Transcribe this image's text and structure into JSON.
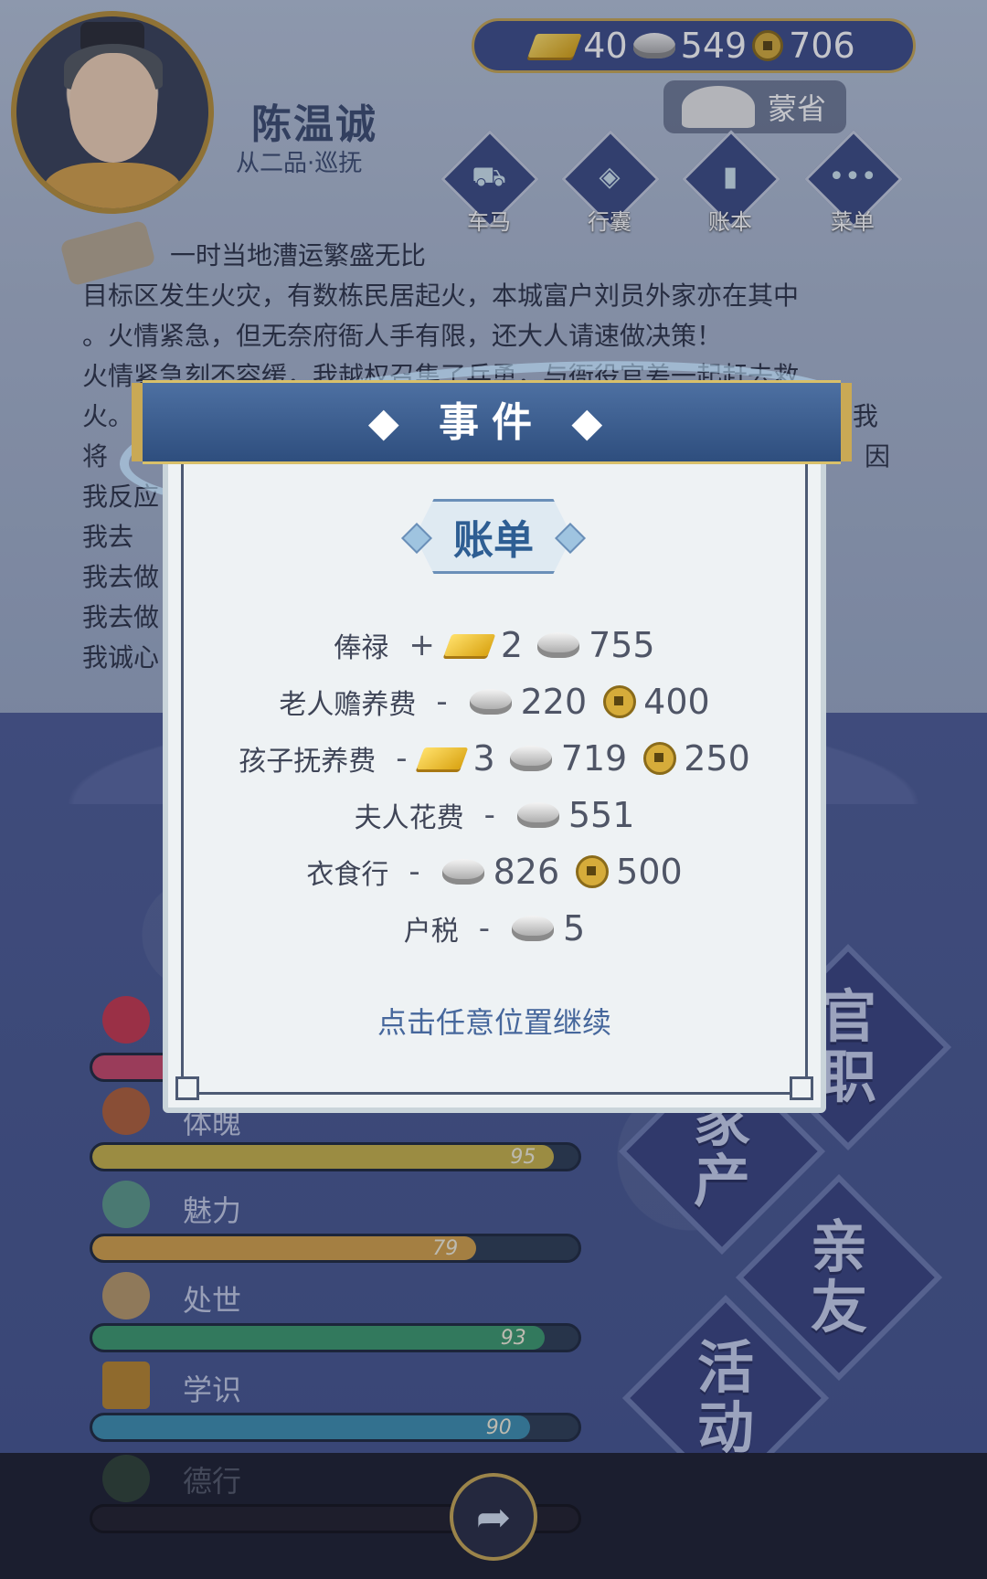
{
  "player": {
    "name": "陈温诚",
    "rank": "从二品·巡抚",
    "province": "蒙省"
  },
  "currency": {
    "gold": "40",
    "silver": "549",
    "coin": "706"
  },
  "nav": [
    {
      "label": "车马",
      "icon": "carriage-icon"
    },
    {
      "label": "行囊",
      "icon": "bag-icon"
    },
    {
      "label": "账本",
      "icon": "ledger-icon"
    },
    {
      "label": "菜单",
      "icon": "menu-dots-icon"
    }
  ],
  "story": {
    "lines": [
      "一时当地漕运繁盛无比",
      "目标区发生火灾，有数栋民居起火，本城富户刘员外家亦在其中",
      "。火情紧急，但无奈府衙人手有限，还大人请速做决策！",
      "火情紧急刻不容缓，我越权召集了兵勇，与衙役官差一起赶去救",
      "火。",
      "将",
      "我反应",
      "我去",
      "我去做",
      "我去做",
      "我诚心"
    ],
    "right_fragments": [
      "灭.我",
      "因"
    ]
  },
  "big_buttons": [
    {
      "label_1": "官",
      "label_2": "职"
    },
    {
      "label_1": "家",
      "label_2": "产"
    },
    {
      "label_1": "亲",
      "label_2": "友"
    },
    {
      "label_1": "活",
      "label_2": "动"
    }
  ],
  "stats": [
    {
      "label": "",
      "value": "",
      "fraction": 0.42,
      "color": "#c7486a"
    },
    {
      "label": "体魄",
      "value": "95",
      "fraction": 0.95,
      "color": "#c9b34a"
    },
    {
      "label": "魅力",
      "value": "79",
      "fraction": 0.79,
      "color": "#d5a24a"
    },
    {
      "label": "处世",
      "value": "93",
      "fraction": 0.93,
      "color": "#3c9a6e"
    },
    {
      "label": "学识",
      "value": "90",
      "fraction": 0.9,
      "color": "#3e8fb0"
    },
    {
      "label": "德行",
      "value": "",
      "fraction": 0.0,
      "color": "#6b5ca0"
    }
  ],
  "dialog": {
    "title": "事件",
    "subtitle": "账单",
    "rows": [
      {
        "label": "俸禄",
        "op": "+",
        "gold": "2",
        "silver": "755",
        "coin": ""
      },
      {
        "label": "老人赡养费",
        "op": "-",
        "gold": "",
        "silver": "220",
        "coin": "400"
      },
      {
        "label": "孩子抚养费",
        "op": "-",
        "gold": "3",
        "silver": "719",
        "coin": "250"
      },
      {
        "label": "夫人花费",
        "op": "-",
        "gold": "",
        "silver": "551",
        "coin": ""
      },
      {
        "label": "衣食行",
        "op": "-",
        "gold": "",
        "silver": "826",
        "coin": "500"
      },
      {
        "label": "户税",
        "op": "-",
        "gold": "",
        "silver": "5",
        "coin": ""
      }
    ],
    "continue_hint": "点击任意位置继续"
  },
  "colors": {
    "dialog_bg": "#eef2f4",
    "header": "#2e4e7e",
    "accent_gold": "#c9a955",
    "continue_text": "#46679c"
  }
}
